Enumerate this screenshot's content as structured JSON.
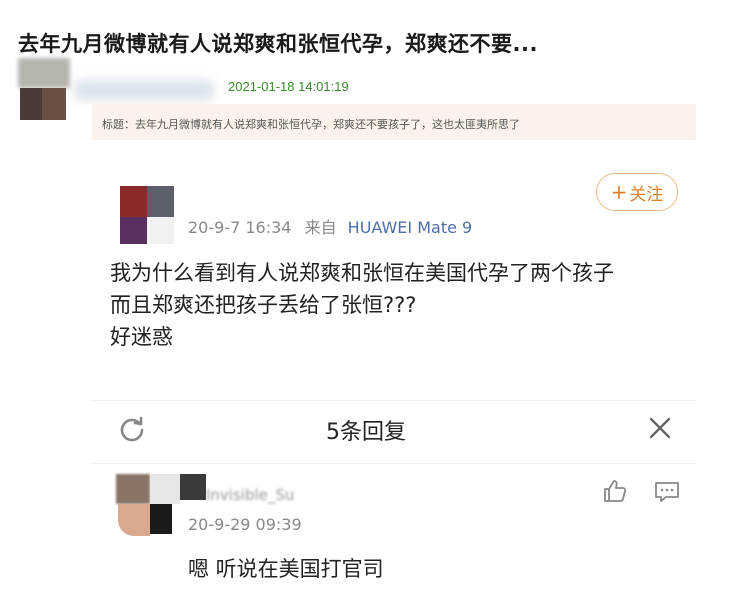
{
  "article": {
    "title": "去年九月微博就有人说郑爽和张恒代孕，郑爽还不要...",
    "date": "2021-01-18 14:01:19",
    "tag_text": "标题：去年九月微博就有人说郑爽和张恒代孕，郑爽还不要孩子了，这也太匪夷所思了"
  },
  "post": {
    "follow_plus": "+",
    "follow_label": "关注",
    "timestamp": "20-9-7 16:34",
    "source_prefix": "来自",
    "device": "HUAWEI Mate 9",
    "lines": [
      "我为什么看到有人说郑爽和张恒在美国代孕了两个孩子",
      "而且郑爽还把孩子丢给了张恒???",
      "好迷惑"
    ]
  },
  "replies": {
    "header": "5条回复",
    "items": [
      {
        "username": "Invisible_Su",
        "timestamp": "20-9-29 09:39",
        "text": "嗯 听说在美国打官司"
      }
    ]
  },
  "colors": {
    "date_green": "#3a8a2e",
    "follow_orange": "#d9822b",
    "device_blue": "#4d6ea3",
    "tag_bg": "#fbf3ea"
  }
}
